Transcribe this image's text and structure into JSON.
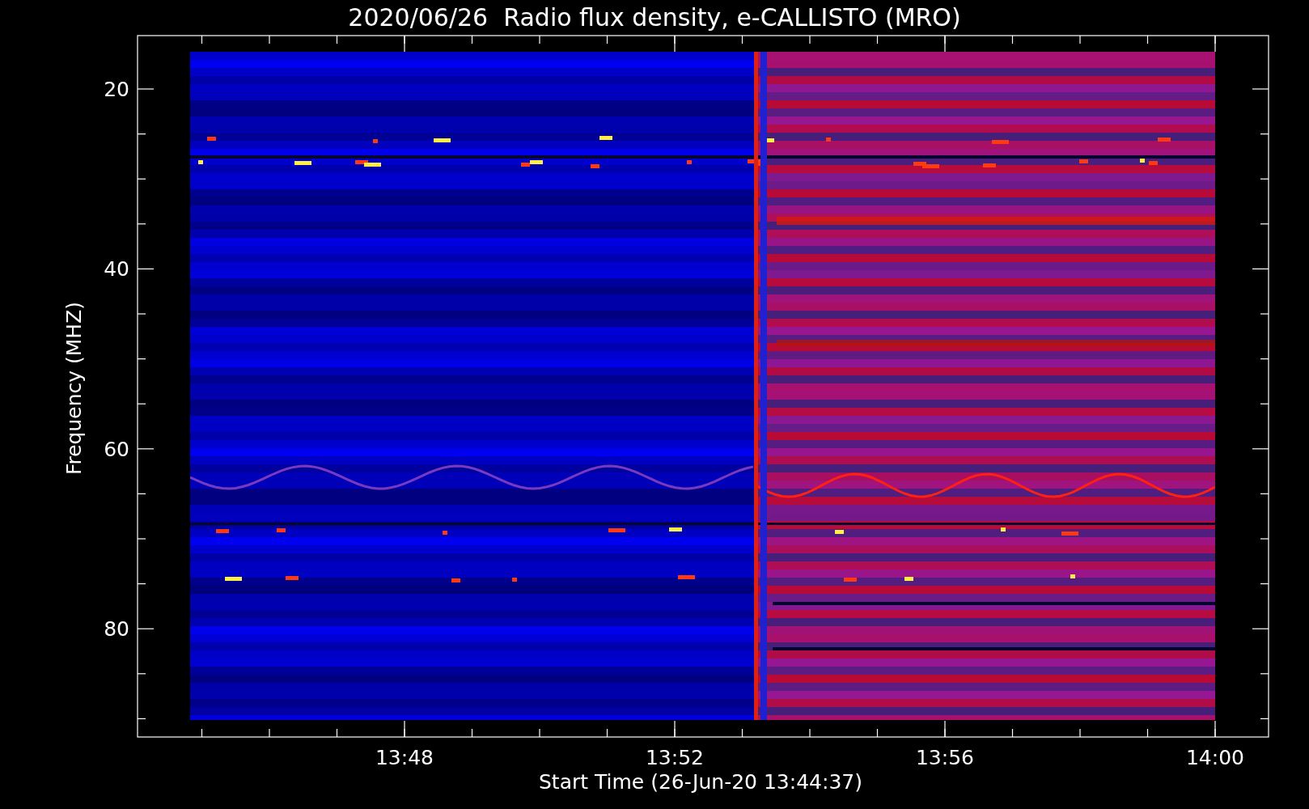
{
  "title": "2020/06/26  Radio flux density, e-CALLISTO (MRO)",
  "y_axis": {
    "label": "Frequency (MHZ)",
    "ticks": [
      "20",
      "40",
      "60",
      "80"
    ]
  },
  "x_axis": {
    "label": "Start Time (26-Jun-20 13:44:37)",
    "ticks": [
      "13:48",
      "13:52",
      "13:56",
      "14:00"
    ]
  }
}
